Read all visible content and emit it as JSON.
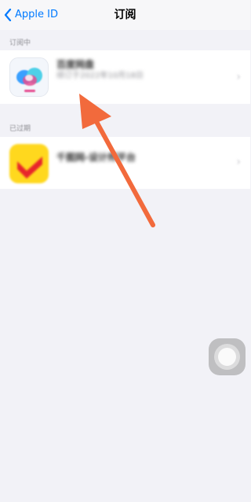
{
  "nav": {
    "back_label": "Apple ID",
    "title": "订阅"
  },
  "sections": {
    "active_header": "订阅中",
    "expired_header": "已过期"
  },
  "subscriptions": {
    "active": {
      "title": "百度网盘",
      "subtitle": "续订于2022年10月18日",
      "detail": ""
    },
    "expired": {
      "title": "千图网-设计师平台",
      "subtitle": ""
    }
  },
  "colors": {
    "accent": "#007aff",
    "annotation_arrow": "#f26a3c",
    "background": "#f2f2f7"
  },
  "icons": {
    "back": "chevron-left-icon",
    "disclosure": "chevron-right-icon",
    "assistive_touch": "assistive-touch-icon"
  }
}
